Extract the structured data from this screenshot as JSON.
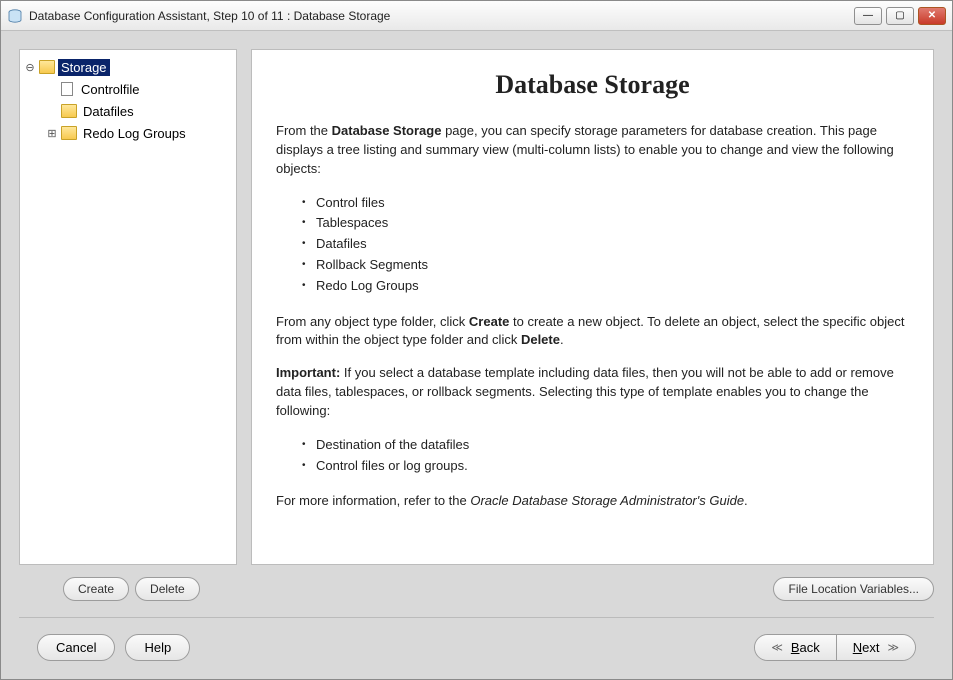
{
  "window": {
    "title": "Database Configuration Assistant, Step 10 of 11 : Database Storage"
  },
  "tree": {
    "root": "Storage",
    "items": {
      "controlfile": "Controlfile",
      "datafiles": "Datafiles",
      "redo": "Redo Log Groups"
    }
  },
  "page": {
    "heading": "Database Storage",
    "intro_a": "From the ",
    "intro_b": "Database Storage",
    "intro_c": " page, you can specify storage parameters for database creation. This page displays a tree listing and summary view (multi-column lists) to enable you to change and view the following objects:",
    "list1": {
      "i0": "Control files",
      "i1": "Tablespaces",
      "i2": "Datafiles",
      "i3": "Rollback Segments",
      "i4": "Redo Log Groups"
    },
    "para2_a": "From any object type folder, click ",
    "para2_b": "Create",
    "para2_c": " to create a new object. To delete an object, select the specific object from within the object type folder and click ",
    "para2_d": "Delete",
    "para2_e": ".",
    "para3_a": "Important:",
    "para3_b": " If you select a database template including data files, then you will not be able to add or remove data files, tablespaces, or rollback segments. Selecting this type of template enables you to change the following:",
    "list2": {
      "i0": "Destination of the datafiles",
      "i1": "Control files or log groups."
    },
    "para4_a": "For more information, refer to the ",
    "para4_b": "Oracle Database Storage Administrator's Guide",
    "para4_c": "."
  },
  "buttons": {
    "create": "Create",
    "delete": "Delete",
    "file_vars": "File Location Variables...",
    "cancel": "Cancel",
    "help": "Help",
    "back": "ack",
    "back_prefix": "B",
    "next_prefix": "N",
    "next": "ext"
  }
}
